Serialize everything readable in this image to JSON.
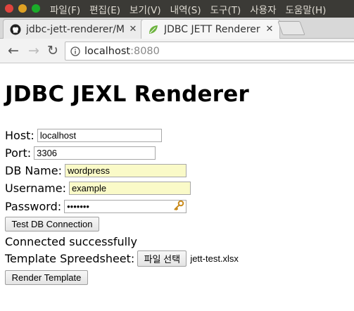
{
  "menubar": {
    "items": [
      "파일(F)",
      "편집(E)",
      "보기(V)",
      "내역(S)",
      "도구(T)",
      "사용자",
      "도움말(H)"
    ],
    "colors": {
      "close": "#e0443e",
      "minimize": "#dea123",
      "maximize": "#1aab29"
    }
  },
  "tabs": [
    {
      "title": "jdbc-jett-renderer/M",
      "icon": "github-icon",
      "close": "✕"
    },
    {
      "title": "JDBC JETT Renderer",
      "icon": "leaf-icon",
      "close": "✕"
    }
  ],
  "toolbar": {
    "back": "←",
    "forward": "→",
    "reload": "↻",
    "url_host": "localhost",
    "url_port": ":8080"
  },
  "page": {
    "title": "JDBC JEXL Renderer",
    "host_label": "Host:",
    "host_value": "localhost",
    "port_label": "Port:",
    "port_value": "3306",
    "dbname_label": "DB Name:",
    "dbname_value": "wordpress",
    "username_label": "Username:",
    "username_value": "example",
    "password_label": "Password:",
    "password_value": "•••••••",
    "test_button": "Test DB Connection",
    "status": "Connected successfully",
    "template_label": "Template Spreedsheet:",
    "file_button": "파일 선택",
    "file_name": "jett-test.xlsx",
    "render_button": "Render Template"
  }
}
